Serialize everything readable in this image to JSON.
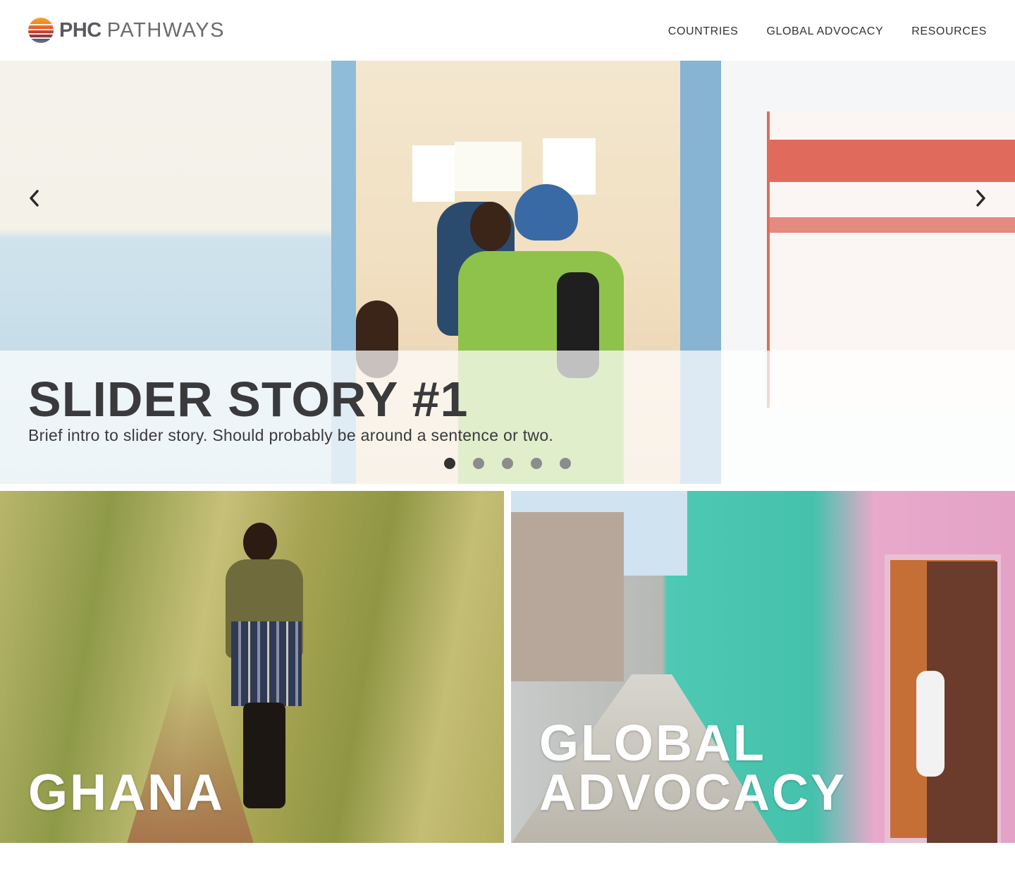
{
  "brand": {
    "name_bold": "PHC",
    "name_light": "PATHWAYS"
  },
  "nav": {
    "items": [
      {
        "label": "COUNTRIES"
      },
      {
        "label": "GLOBAL ADVOCACY"
      },
      {
        "label": "RESOURCES"
      }
    ]
  },
  "slider": {
    "title": "SLIDER STORY #1",
    "intro": "Brief intro to slider story. Should probably be around a sentence or two.",
    "slide_count": 5,
    "active_slide": 1,
    "prev_icon": "chevron-left-icon",
    "next_icon": "chevron-right-icon"
  },
  "tiles": [
    {
      "label": "GHANA"
    },
    {
      "label_line1": "GLOBAL",
      "label_line2": "ADVOCACY"
    }
  ],
  "colors": {
    "text_dark": "#3a3a3c",
    "dot_active": "#333333",
    "dot_inactive": "#8c8c8c"
  }
}
